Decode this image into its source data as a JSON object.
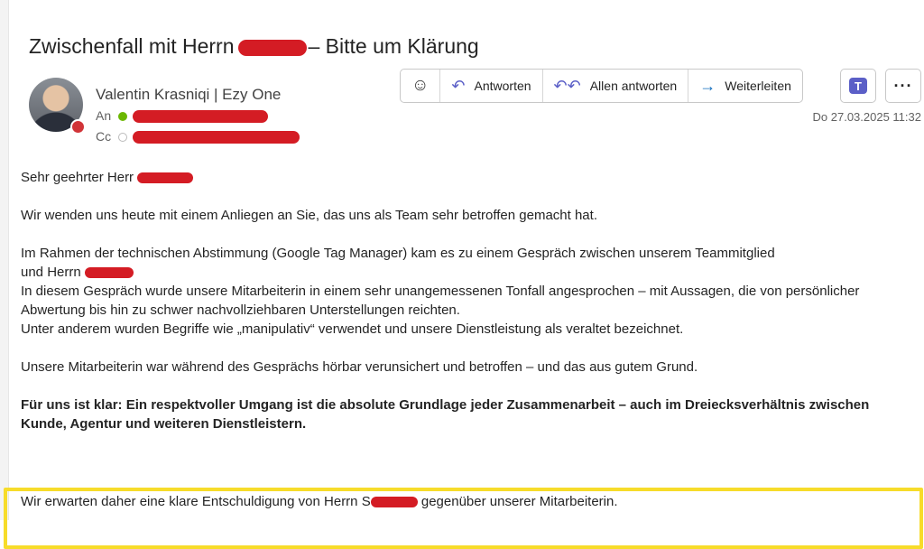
{
  "subject": {
    "before": "Zwischenfall mit Herrn",
    "after": "– Bitte um Klärung"
  },
  "sender": {
    "name": "Valentin Krasniqi | Ezy One"
  },
  "recipients": {
    "to_label": "An",
    "cc_label": "Cc"
  },
  "toolbar": {
    "emoji_icon": "emoji-icon",
    "reply_label": "Antworten",
    "reply_all_label": "Allen antworten",
    "forward_label": "Weiterleiten",
    "teams_icon": "teams-icon",
    "more_icon": "more-icon"
  },
  "date": "Do 27.03.2025 11:32",
  "body": {
    "greeting": "Sehr geehrter Herr",
    "p1": "Wir wenden uns heute mit einem Anliegen an Sie, das uns als Team sehr betroffen gemacht hat.",
    "p2_line1": "Im Rahmen der technischen Abstimmung (Google Tag Manager) kam es zu einem Gespräch zwischen unserem Teammitglied",
    "p2_line2": "und Herrn",
    "p2_line3": "In diesem Gespräch wurde unsere Mitarbeiterin in einem sehr unangemessenen Tonfall angesprochen – mit Aussagen, die von persönlicher Abwertung bis hin zu schwer nachvollziehbaren Unterstellungen reichten.",
    "p2_line4": "Unter anderem wurden Begriffe wie „manipulativ“ verwendet und unsere Dienstleistung als veraltet bezeichnet.",
    "p3": "Unsere Mitarbeiterin war während des Gesprächs hörbar verunsichert und betroffen – und das aus gutem Grund.",
    "p4": "Für uns ist klar: Ein respektvoller Umgang ist die absolute Grundlage jeder Zusammenarbeit – auch im Dreiecksverhältnis zwischen Kunde, Agentur und weiteren Dienstleistern.",
    "p5_before": "Wir erwarten daher eine klare Entschuldigung von Herrn S",
    "p5_after": "gegenüber unserer Mitarbeiterin."
  },
  "colors": {
    "redaction": "#d41c24",
    "highlight_border": "#f7dc2a",
    "accent": "#5b5fc7"
  }
}
